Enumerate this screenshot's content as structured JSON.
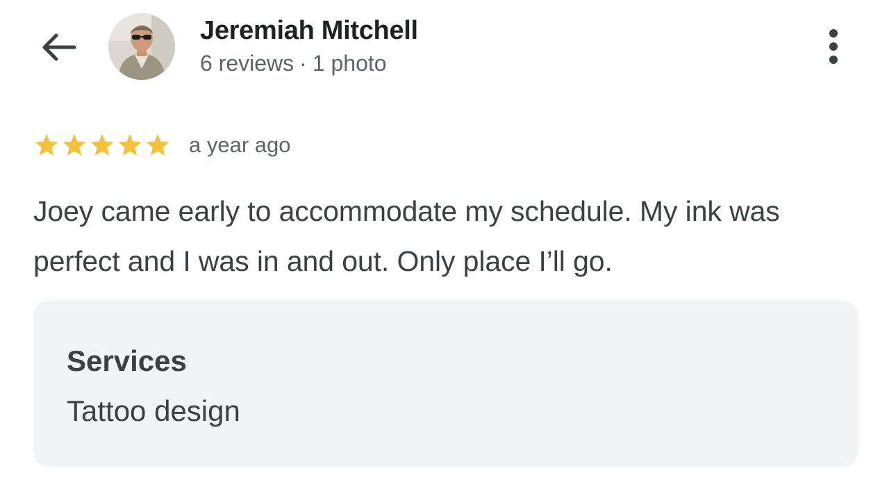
{
  "header": {
    "back_icon": "arrow-left-icon",
    "reviewer_name": "Jeremiah Mitchell",
    "reviews_count": "6 reviews",
    "separator": "·",
    "photos_count": "1 photo",
    "more_icon": "more-vert-icon"
  },
  "review": {
    "rating": 5,
    "rating_max": 5,
    "star_color": "#f4c13d",
    "time_ago": "a year ago",
    "text": "Joey came early to accommodate my schedule. My ink was perfect and I was in and out. Only place I’ll go."
  },
  "services": {
    "title": "Services",
    "value": "Tattoo design"
  }
}
